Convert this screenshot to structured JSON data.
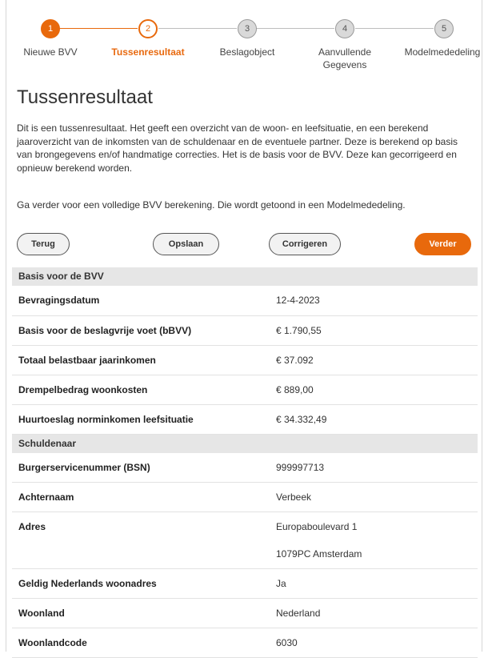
{
  "stepper": {
    "steps": [
      {
        "number": "1",
        "label": "Nieuwe BVV",
        "state": "done"
      },
      {
        "number": "2",
        "label": "Tussenresultaat",
        "state": "active"
      },
      {
        "number": "3",
        "label": "Beslagobject",
        "state": "todo"
      },
      {
        "number": "4",
        "label": "Aanvullende Gegevens",
        "state": "todo"
      },
      {
        "number": "5",
        "label": "Modelmededeling",
        "state": "todo"
      }
    ]
  },
  "page": {
    "title": "Tussenresultaat",
    "intro": "Dit is een tussenresultaat. Het geeft een overzicht van de woon- en leefsituatie, en een berekend jaaroverzicht van de inkomsten van de schuldenaar en de eventuele partner. Deze is berekend op basis van brongegevens en/of handmatige correcties. Het is de basis voor de BVV. Deze kan gecorrigeerd en opnieuw berekend worden.",
    "intro2": "Ga verder voor een volledige BVV berekening. Die wordt getoond in een Modelmededeling."
  },
  "buttons": {
    "back": "Terug",
    "save": "Opslaan",
    "correct": "Corrigeren",
    "next": "Verder"
  },
  "sections": {
    "basis": {
      "title": "Basis voor de BVV",
      "rows": [
        {
          "label": "Bevragingsdatum",
          "value": "12-4-2023"
        },
        {
          "label": "Basis voor de beslagvrije voet (bBVV)",
          "value": "€ 1.790,55"
        },
        {
          "label": "Totaal belastbaar jaarinkomen",
          "value": "€ 37.092"
        },
        {
          "label": "Drempelbedrag woonkosten",
          "value": "€ 889,00"
        },
        {
          "label": "Huurtoeslag norminkomen leefsituatie",
          "value": "€ 34.332,49"
        }
      ]
    },
    "schuldenaar": {
      "title": "Schuldenaar",
      "rows": [
        {
          "label": "Burgerservicenummer (BSN)",
          "value": "999997713"
        },
        {
          "label": "Achternaam",
          "value": "Verbeek"
        },
        {
          "label": "Adres",
          "value": "Europaboulevard 1",
          "value2": "1079PC Amsterdam"
        },
        {
          "label": "Geldig Nederlands woonadres",
          "value": "Ja"
        },
        {
          "label": "Woonland",
          "value": "Nederland"
        },
        {
          "label": "Woonlandcode",
          "value": "6030"
        }
      ]
    }
  },
  "colors": {
    "accent": "#e8690c",
    "inactive_step": "#d9d9d9",
    "section_bg": "#e6e6e6"
  }
}
